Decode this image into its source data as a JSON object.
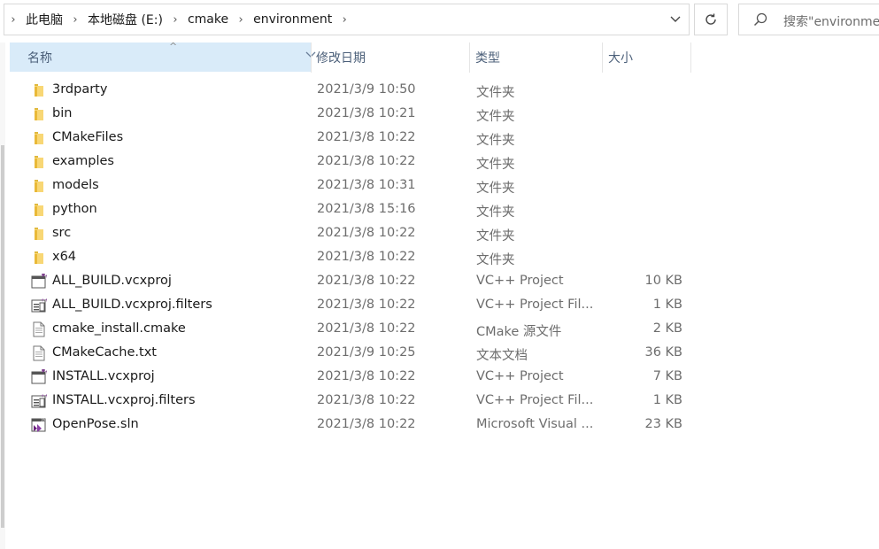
{
  "address_bar": {
    "crumbs": [
      "此电脑",
      "本地磁盘 (E:)",
      "cmake",
      "environment"
    ]
  },
  "search": {
    "placeholder": "搜索\"environment\""
  },
  "columns": {
    "name": "名称",
    "date": "修改日期",
    "type": "类型",
    "size": "大小"
  },
  "files": [
    {
      "name": "3rdparty",
      "date": "2021/3/9 10:50",
      "type": "文件夹",
      "size": "",
      "icon": "folder-icon"
    },
    {
      "name": "bin",
      "date": "2021/3/8 10:21",
      "type": "文件夹",
      "size": "",
      "icon": "folder-icon"
    },
    {
      "name": "CMakeFiles",
      "date": "2021/3/8 10:22",
      "type": "文件夹",
      "size": "",
      "icon": "folder-icon"
    },
    {
      "name": "examples",
      "date": "2021/3/8 10:22",
      "type": "文件夹",
      "size": "",
      "icon": "folder-icon"
    },
    {
      "name": "models",
      "date": "2021/3/8 10:31",
      "type": "文件夹",
      "size": "",
      "icon": "folder-icon"
    },
    {
      "name": "python",
      "date": "2021/3/8 15:16",
      "type": "文件夹",
      "size": "",
      "icon": "folder-icon"
    },
    {
      "name": "src",
      "date": "2021/3/8 10:22",
      "type": "文件夹",
      "size": "",
      "icon": "folder-icon"
    },
    {
      "name": "x64",
      "date": "2021/3/8 10:22",
      "type": "文件夹",
      "size": "",
      "icon": "folder-icon"
    },
    {
      "name": "ALL_BUILD.vcxproj",
      "date": "2021/3/8 10:22",
      "type": "VC++ Project",
      "size": "10 KB",
      "icon": "vcxproj-file-icon"
    },
    {
      "name": "ALL_BUILD.vcxproj.filters",
      "date": "2021/3/8 10:22",
      "type": "VC++ Project Fil...",
      "size": "1 KB",
      "icon": "vcxproj-filters-file-icon"
    },
    {
      "name": "cmake_install.cmake",
      "date": "2021/3/8 10:22",
      "type": "CMake 源文件",
      "size": "2 KB",
      "icon": "text-file-icon"
    },
    {
      "name": "CMakeCache.txt",
      "date": "2021/3/9 10:25",
      "type": "文本文档",
      "size": "36 KB",
      "icon": "text-file-icon"
    },
    {
      "name": "INSTALL.vcxproj",
      "date": "2021/3/8 10:22",
      "type": "VC++ Project",
      "size": "7 KB",
      "icon": "vcxproj-file-icon"
    },
    {
      "name": "INSTALL.vcxproj.filters",
      "date": "2021/3/8 10:22",
      "type": "VC++ Project Fil...",
      "size": "1 KB",
      "icon": "vcxproj-filters-file-icon"
    },
    {
      "name": "OpenPose.sln",
      "date": "2021/3/8 10:22",
      "type": "Microsoft Visual ...",
      "size": "23 KB",
      "icon": "solution-file-icon"
    }
  ],
  "colors": {
    "header_selected_bg": "#d9ebf9",
    "folder_yellow": "#f8d775",
    "vs_purple": "#68217a"
  }
}
